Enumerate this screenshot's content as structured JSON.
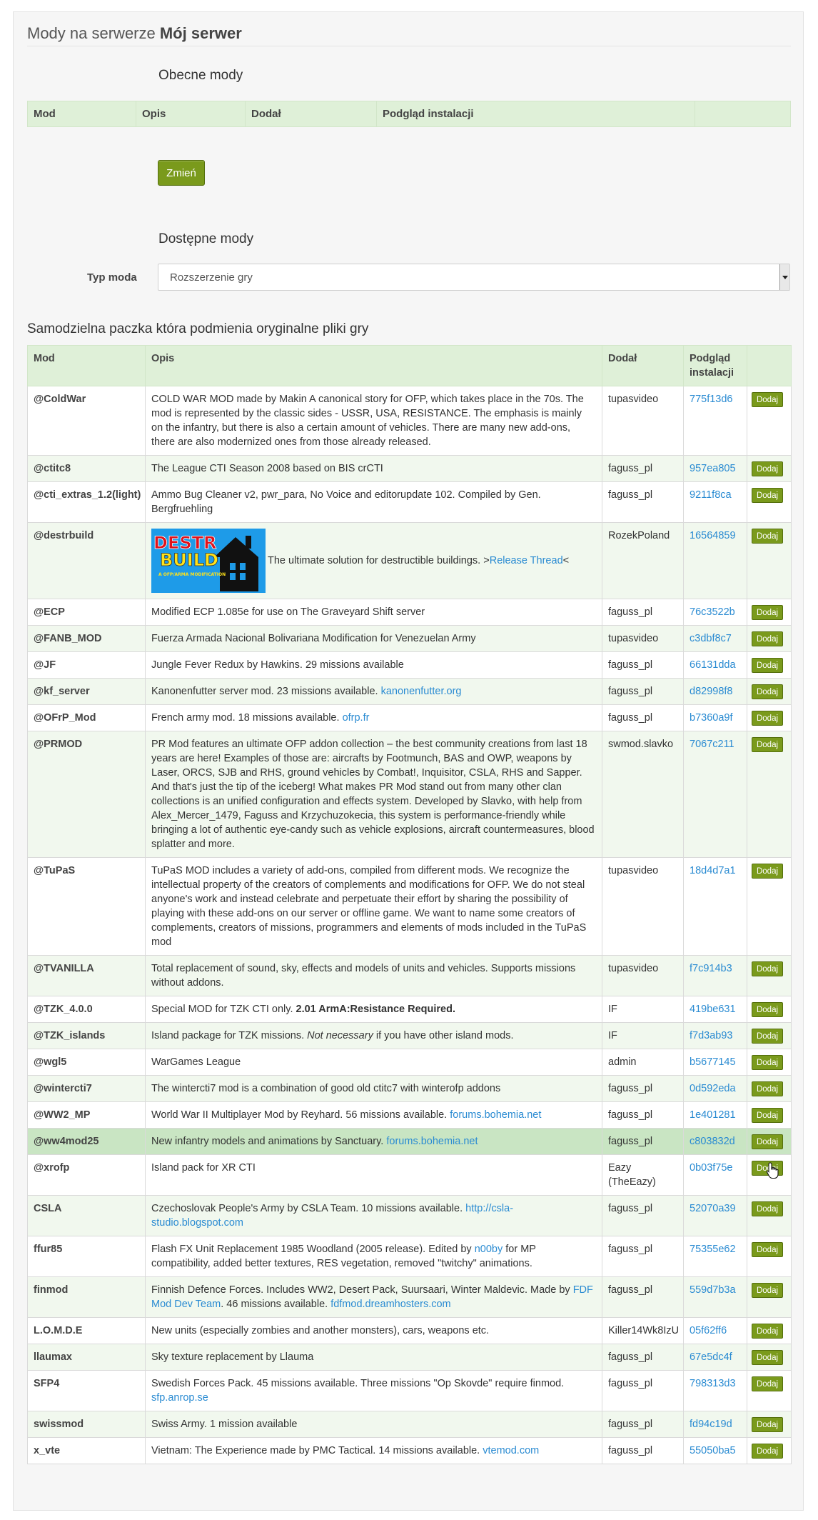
{
  "page": {
    "title_prefix": "Mody na serwerze ",
    "server_name": "Mój serwer"
  },
  "current": {
    "heading": "Obecne mody",
    "columns": [
      "Mod",
      "Opis",
      "Dodał",
      "Podgląd instalacji",
      ""
    ],
    "change_button": "Zmień"
  },
  "available": {
    "heading": "Dostępne mody",
    "type_label": "Typ moda",
    "type_value": "Rozszerzenie gry",
    "section_title": "Samodzielna paczka która podmienia oryginalne pliki gry",
    "columns": {
      "mod": "Mod",
      "desc": "Opis",
      "author": "Dodał",
      "preview": "Podgląd instalacji"
    },
    "add_label": "Dodaj"
  },
  "mods": [
    {
      "name": "@ColdWar",
      "desc": "COLD WAR MOD made by Makin A canonical story for OFP, which takes place in the 70s. The mod is represented by the classic sides - USSR, USA, RESISTANCE. The emphasis is mainly on the infantry, but there is also a certain amount of vehicles. There are many new add-ons, there are also modernized ones from those already released.",
      "author": "tupasvideo",
      "hash": "775f13d6"
    },
    {
      "name": "@ctitc8",
      "desc": "The League CTI Season 2008 based on BIS crCTI",
      "author": "faguss_pl",
      "hash": "957ea805"
    },
    {
      "name": "@cti_extras_1.2(light)",
      "desc": "Ammo Bug Cleaner v2, pwr_para, No Voice and editorupdate 102. Compiled by Gen. Bergfruehling",
      "author": "faguss_pl",
      "hash": "9211f8ca"
    },
    {
      "name": "@destrbuild",
      "desc": "The ultimate solution for destructible buildings. >",
      "link": "Release Thread",
      "desc_after": "<",
      "image": {
        "line1": "DESTR",
        "line2": "BUILD",
        "line3": "A OFP/ARMA MODIFICATION"
      },
      "author": "RozekPoland",
      "hash": "16564859"
    },
    {
      "name": "@ECP",
      "desc": "Modified ECP 1.085e for use on The Graveyard Shift server",
      "author": "faguss_pl",
      "hash": "76c3522b"
    },
    {
      "name": "@FANB_MOD",
      "desc": "Fuerza Armada Nacional Bolivariana Modification for Venezuelan Army",
      "author": "tupasvideo",
      "hash": "c3dbf8c7"
    },
    {
      "name": "@JF",
      "desc": "Jungle Fever Redux by Hawkins. 29 missions available",
      "author": "faguss_pl",
      "hash": "66131dda"
    },
    {
      "name": "@kf_server",
      "desc": "Kanonenfutter server mod. 23 missions available. ",
      "link": "kanonenfutter.org",
      "author": "faguss_pl",
      "hash": "d82998f8"
    },
    {
      "name": "@OFrP_Mod",
      "desc": "French army mod. 18 missions available. ",
      "link": "ofrp.fr",
      "author": "faguss_pl",
      "hash": "b7360a9f"
    },
    {
      "name": "@PRMOD",
      "desc": "PR Mod features an ultimate OFP addon collection – the best community creations from last 18 years are here! Examples of those are: aircrafts by Footmunch, BAS and OWP, weapons by Laser, ORCS, SJB and RHS, ground vehicles by Combat!, Inquisitor, CSLA, RHS and Sapper. And that's just the tip of the iceberg! What makes PR Mod stand out from many other clan collections is an unified configuration and effects system. Developed by Slavko, with help from Alex_Mercer_1479, Faguss and Krzychuzokecia, this system is performance-friendly while bringing a lot of authentic eye-candy such as vehicle explosions, aircraft countermeasures, blood splatter and more.",
      "author": "swmod.slavko",
      "hash": "7067c211"
    },
    {
      "name": "@TuPaS",
      "desc": "TuPaS MOD includes a variety of add-ons, compiled from different mods. We recognize the intellectual property of the creators of complements and modifications for OFP. We do not steal anyone's work and instead celebrate and perpetuate their effort by sharing the possibility of playing with these add-ons on our server or offline game. We want to name some creators of complements, creators of missions, programmers and elements of mods included in the TuPaS mod",
      "author": "tupasvideo",
      "hash": "18d4d7a1"
    },
    {
      "name": "@TVANILLA",
      "desc": "Total replacement of sound, sky, effects and models of units and vehicles. Supports missions without addons.",
      "author": "tupasvideo",
      "hash": "f7c914b3"
    },
    {
      "name": "@TZK_4.0.0",
      "desc": "Special MOD for TZK CTI only. ",
      "bold": "2.01 ArmA:Resistance Required.",
      "author": "IF",
      "hash": "419be631"
    },
    {
      "name": "@TZK_islands",
      "desc": "Island package for TZK missions. ",
      "italic": "Not necessary",
      "desc_after": " if you have other island mods.",
      "author": "IF",
      "hash": "f7d3ab93"
    },
    {
      "name": "@wgl5",
      "desc": "WarGames League",
      "author": "admin",
      "hash": "b5677145"
    },
    {
      "name": "@wintercti7",
      "desc": "The wintercti7 mod is a combination of good old ctitc7 with winterofp addons",
      "author": "faguss_pl",
      "hash": "0d592eda"
    },
    {
      "name": "@WW2_MP",
      "desc": "World War II Multiplayer Mod by Reyhard. 56 missions available. ",
      "link": "forums.bohemia.net",
      "author": "faguss_pl",
      "hash": "1e401281"
    },
    {
      "name": "@ww4mod25",
      "desc": "New infantry models and animations by Sanctuary. ",
      "link": "forums.bohemia.net",
      "author": "faguss_pl",
      "hash": "c803832d",
      "highlight": true
    },
    {
      "name": "@xrofp",
      "desc": "Island pack for XR CTI",
      "author": "Eazy (TheEazy)",
      "hash": "0b03f75e"
    },
    {
      "name": "CSLA",
      "desc": "Czechoslovak People's Army by CSLA Team. 10 missions available. ",
      "link": "http://csla-studio.blogspot.com",
      "author": "faguss_pl",
      "hash": "52070a39"
    },
    {
      "name": "ffur85",
      "desc": "Flash FX Unit Replacement 1985 Woodland (2005 release). Edited by ",
      "link": "n00by",
      "desc_after": " for MP compatibility, added better textures, RES vegetation, removed \"twitchy\" animations.",
      "author": "faguss_pl",
      "hash": "75355e62"
    },
    {
      "name": "finmod",
      "desc": "Finnish Defence Forces. Includes WW2, Desert Pack, Suursaari, Winter Maldevic. Made by ",
      "link": "FDF Mod Dev Team",
      "desc_after": ". 46 missions available. ",
      "link2": "fdfmod.dreamhosters.com",
      "author": "faguss_pl",
      "hash": "559d7b3a"
    },
    {
      "name": "L.O.M.D.E",
      "desc": "New units (especially zombies and another monsters), cars, weapons etc.",
      "author": "Killer14Wk8IzU",
      "hash": "05f62ff6"
    },
    {
      "name": "llaumax",
      "desc": "Sky texture replacement by Llauma",
      "author": "faguss_pl",
      "hash": "67e5dc4f"
    },
    {
      "name": "SFP4",
      "desc": "Swedish Forces Pack. 45 missions available. Three missions \"Op Skovde\" require finmod. ",
      "link": "sfp.anrop.se",
      "author": "faguss_pl",
      "hash": "798313d3"
    },
    {
      "name": "swissmod",
      "desc": "Swiss Army. 1 mission available",
      "author": "faguss_pl",
      "hash": "fd94c19d"
    },
    {
      "name": "x_vte",
      "desc": "Vietnam: The Experience made by PMC Tactical. 14 missions available. ",
      "link": "vtemod.com",
      "author": "faguss_pl",
      "hash": "55050ba5"
    }
  ]
}
